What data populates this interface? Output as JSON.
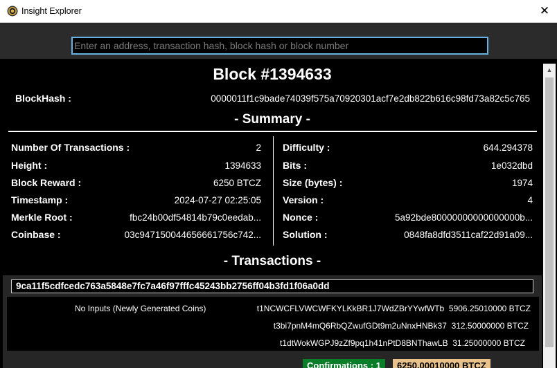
{
  "window": {
    "title": "Insight Explorer",
    "close_glyph": "✕"
  },
  "search": {
    "placeholder": "Enter an address, transaction hash, block hash or block number"
  },
  "block": {
    "title": "Block #1394633",
    "blockhash_label": "BlockHash :",
    "blockhash_value": "0000011f1c9bade74039f575a70920301acf7e2db822b616c98fd73a82c5c765"
  },
  "summary": {
    "title": "- Summary -",
    "left": [
      {
        "label": "Number Of Transactions :",
        "value": "2"
      },
      {
        "label": "Height :",
        "value": "1394633"
      },
      {
        "label": "Block Reward :",
        "value": "6250 BTCZ"
      },
      {
        "label": "Timestamp :",
        "value": "2024-07-27 02:25:05"
      },
      {
        "label": "Merkle Root :",
        "value": "fbc24b00df54814b79c0eedab..."
      },
      {
        "label": "Coinbase :",
        "value": "03c947150044656661756c742..."
      }
    ],
    "right": [
      {
        "label": "Difficulty :",
        "value": "644.294378"
      },
      {
        "label": "Bits :",
        "value": "1e032dbd"
      },
      {
        "label": "Size (bytes) :",
        "value": "1974"
      },
      {
        "label": "Version :",
        "value": "4"
      },
      {
        "label": "Nonce :",
        "value": "5a92bde80000000000000000b..."
      },
      {
        "label": "Solution :",
        "value": "0848fa8dfd3511caf22d91a09..."
      }
    ]
  },
  "transactions": {
    "title": "- Transactions -",
    "tx": {
      "hash": "9ca11f5cdfcedc763a5848e7fc7a46f97fffc45243bb2756ff04b3fd1f06a0dd",
      "inputs_text": "No Inputs (Newly Generated Coins)",
      "outputs": [
        {
          "address": "t1NCWCFLVWCWFKYLKkBR1J7WdZBrYYwfWTb",
          "amount": "5906.25010000 BTCZ"
        },
        {
          "address": "t3bi7pnM4mQ6RbQZwufGDt9m2uNnxHNBk37",
          "amount": "312.50000000 BTCZ"
        },
        {
          "address": "t1dtWokWGPJ9zZf9pq1h41nPtD8BNThawLB",
          "amount": "31.25000000 BTCZ"
        }
      ],
      "confirmations": "Confirmations : 1",
      "total": "6250.00010000 BTCZ"
    }
  },
  "colors": {
    "confirm_bg": "#0a7d28",
    "total_bg": "#e8c28a",
    "search_border": "#66b3e6"
  },
  "icons": {
    "app": "insight-coin-icon",
    "scroll_up": "chevron-up-icon"
  }
}
